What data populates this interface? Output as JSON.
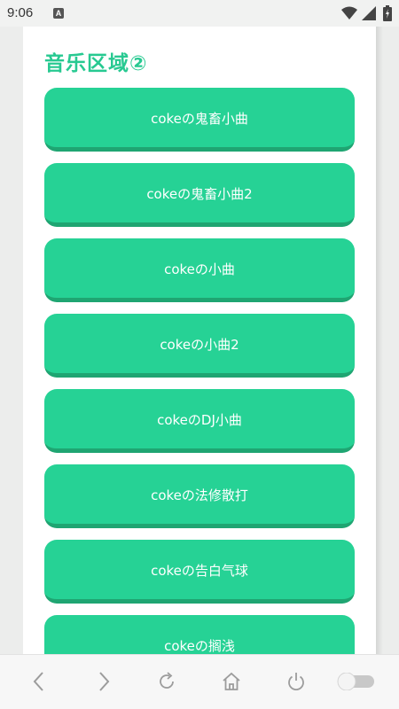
{
  "status_bar": {
    "time": "9:06",
    "notification_glyph": "A"
  },
  "section": {
    "title": "音乐区域②"
  },
  "buttons": [
    {
      "label": "cokeの鬼畜小曲"
    },
    {
      "label": "cokeの鬼畜小曲2"
    },
    {
      "label": "cokeの小曲"
    },
    {
      "label": "cokeの小曲2"
    },
    {
      "label": "cokeのDJ小曲"
    },
    {
      "label": "cokeの法修散打"
    },
    {
      "label": "cokeの告白气球"
    },
    {
      "label": "cokeの搁浅"
    }
  ],
  "colors": {
    "accent": "#26d295",
    "accent_dark": "#1fa572",
    "title": "#27c991"
  },
  "nav_bar": {
    "icons": [
      "back-arrow-icon",
      "forward-arrow-icon",
      "refresh-icon",
      "home-icon",
      "power-icon",
      "toggle-switch"
    ]
  }
}
